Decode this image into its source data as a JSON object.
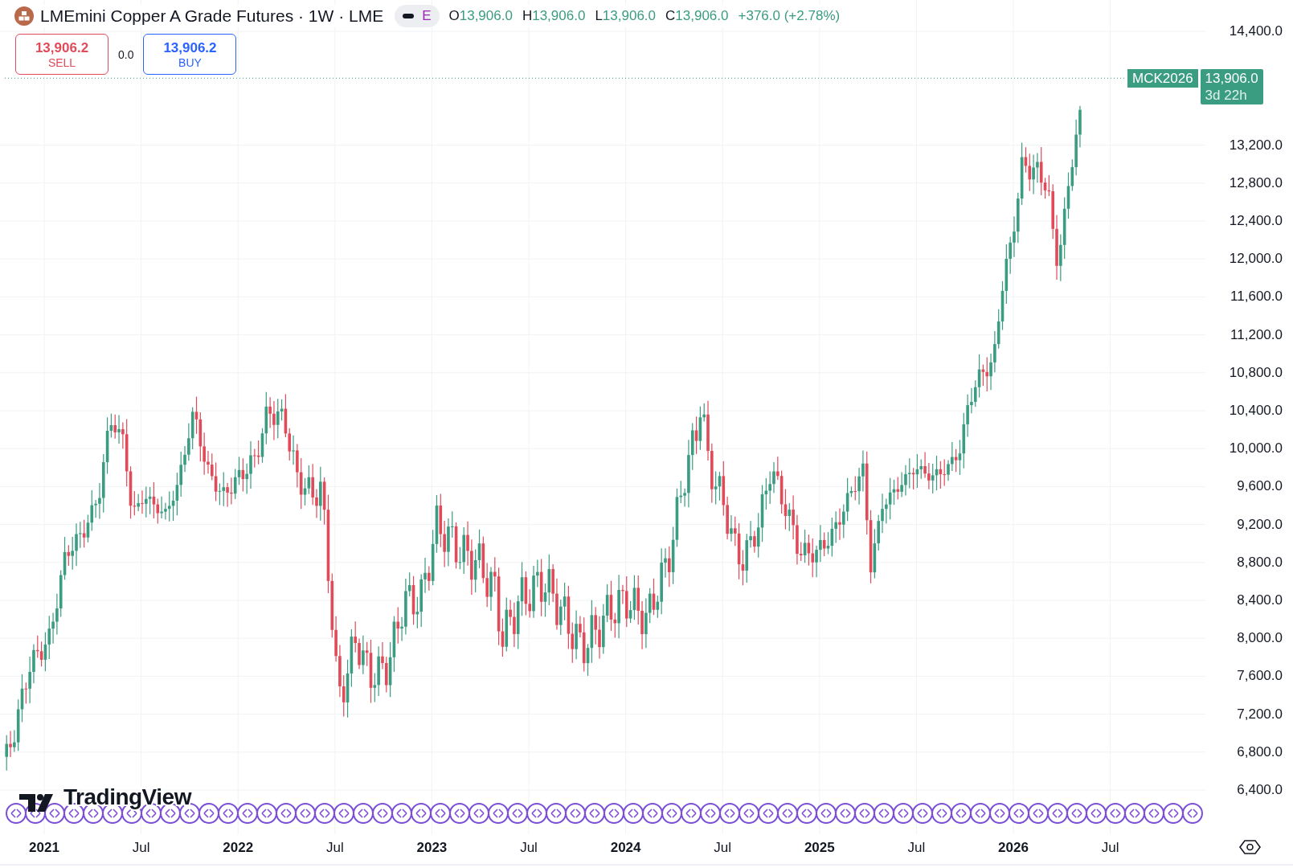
{
  "header": {
    "title": "LMEmini Copper A Grade Futures · 1W · LME",
    "session_badge": "E",
    "ohlc": [
      {
        "label": "O",
        "value": "13,906.0"
      },
      {
        "label": "H",
        "value": "13,906.0"
      },
      {
        "label": "L",
        "value": "13,906.0"
      },
      {
        "label": "C",
        "value": "13,906.0"
      }
    ],
    "change": "+376.0 (+2.78%)"
  },
  "trade": {
    "sell_price": "13,906.2",
    "sell_label": "SELL",
    "spread": "0.0",
    "buy_price": "13,906.2",
    "buy_label": "BUY"
  },
  "price_tag": {
    "symbol": "MCK2026",
    "price": "13,906.0",
    "countdown": "3d 22h"
  },
  "y_axis": [
    "14,400.0",
    "13,200.0",
    "12,800.0",
    "12,400.0",
    "12,000.0",
    "11,600.0",
    "11,200.0",
    "10,800.0",
    "10,400.0",
    "10,000.0",
    "9,600.0",
    "9,200.0",
    "8,800.0",
    "8,400.0",
    "8,000.0",
    "7,600.0",
    "7,200.0",
    "6,800.0",
    "6,400.0"
  ],
  "x_axis": [
    {
      "label": "2021",
      "major": true
    },
    {
      "label": "Jul",
      "major": false
    },
    {
      "label": "2022",
      "major": true
    },
    {
      "label": "Jul",
      "major": false
    },
    {
      "label": "2023",
      "major": true
    },
    {
      "label": "Jul",
      "major": false
    },
    {
      "label": "2024",
      "major": true
    },
    {
      "label": "Jul",
      "major": false
    },
    {
      "label": "2025",
      "major": true
    },
    {
      "label": "Jul",
      "major": false
    },
    {
      "label": "2026",
      "major": true
    },
    {
      "label": "Jul",
      "major": false
    }
  ],
  "branding": "TradingView"
}
